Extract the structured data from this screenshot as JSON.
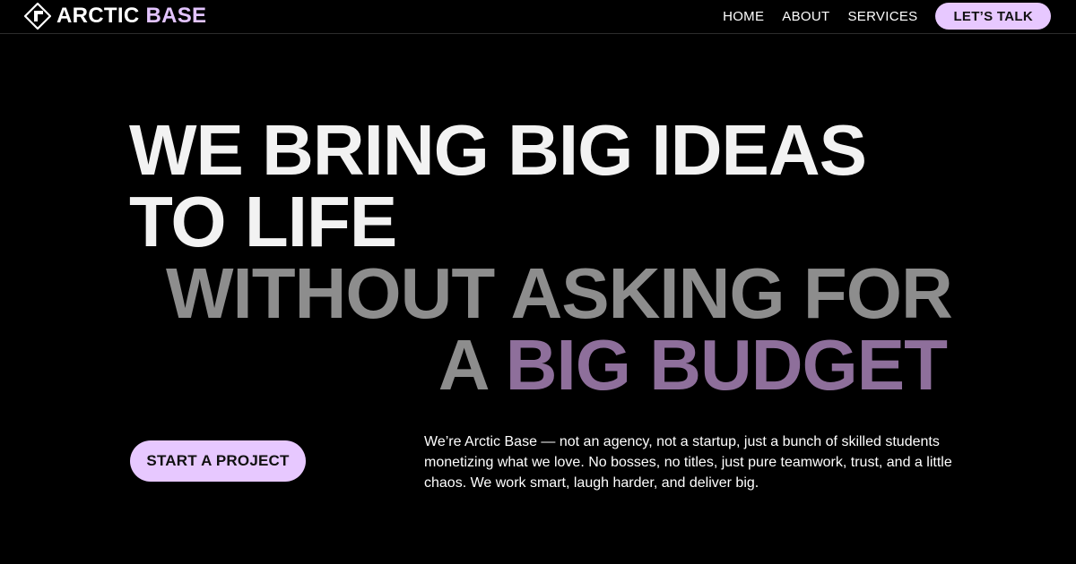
{
  "brand": {
    "name_part1": "ARCTIC",
    "name_part2": "BASE",
    "logo_icon": "arctic-base-logo-icon"
  },
  "nav": {
    "items": [
      {
        "label": "HOME"
      },
      {
        "label": "ABOUT"
      },
      {
        "label": "SERVICES"
      }
    ],
    "cta_label": "LET’S TALK"
  },
  "hero": {
    "line1": "WE BRING BIG IDEAS",
    "line2": "TO LIFE",
    "line3": "WITHOUT ASKING FOR",
    "line4_prefix": "A ",
    "line4_accent": "BIG BUDGET"
  },
  "cta": {
    "label": "START A PROJECT"
  },
  "intro": {
    "text": "We’re Arctic Base — not an agency, not a startup, just a bunch of skilled students monetizing what we love. No bosses, no titles, just pure teamwork, trust, and a little chaos. We work smart, laugh harder, and deliver big."
  },
  "colors": {
    "background": "#000000",
    "primary_text": "#f2f2f2",
    "muted_text": "#8d8d8d",
    "accent_lavender": "#e7c8ff",
    "accent_purple": "#8e6f9b"
  }
}
